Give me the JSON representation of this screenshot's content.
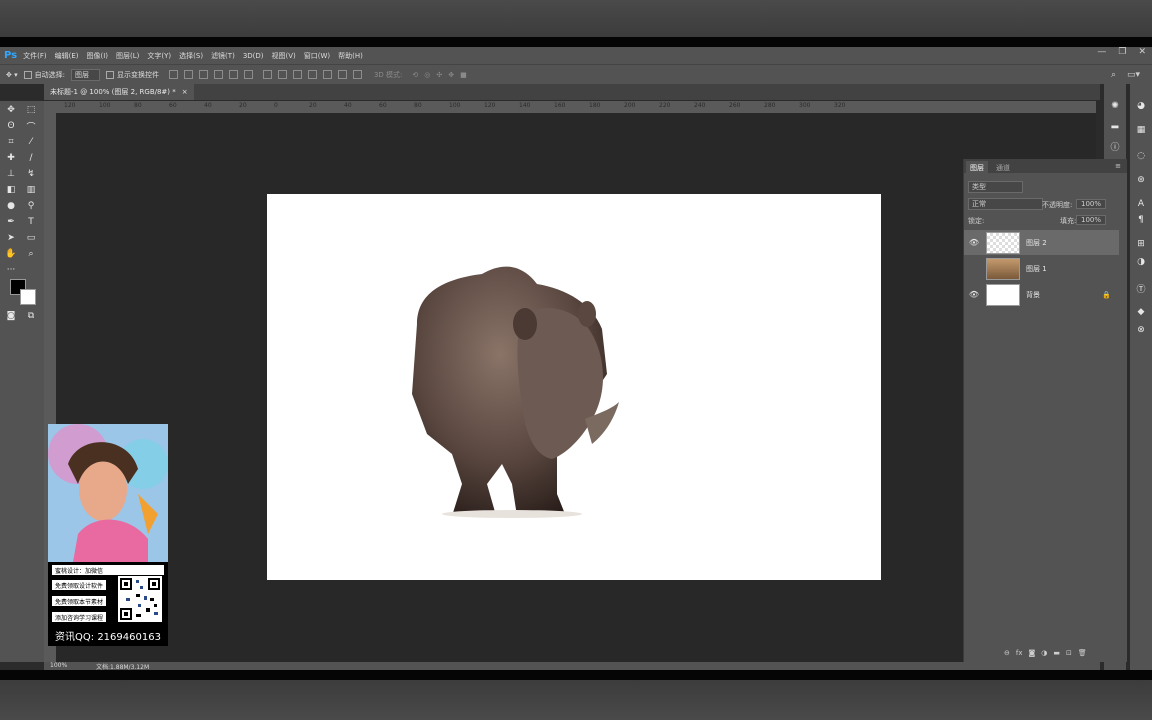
{
  "menubar": {
    "logo": "Ps",
    "items": [
      "文件(F)",
      "编辑(E)",
      "图像(I)",
      "图层(L)",
      "文字(Y)",
      "选择(S)",
      "滤镜(T)",
      "3D(D)",
      "视图(V)",
      "窗口(W)",
      "帮助(H)"
    ]
  },
  "window_controls": {
    "minimize": "—",
    "restore": "❐",
    "close": "✕"
  },
  "options": {
    "auto_select_label": "自动选择:",
    "auto_select_value": "图层",
    "show_transform_label": "显示变换控件",
    "mode_3d_label": "3D 模式:"
  },
  "document_tab": {
    "label": "未标题-1 @ 100% (图层 2, RGB/8#) *",
    "close": "×"
  },
  "ruler_h_ticks": [
    "120",
    "100",
    "80",
    "60",
    "40",
    "20",
    "0",
    "20",
    "40",
    "60",
    "80",
    "100",
    "120",
    "140",
    "160",
    "180",
    "200",
    "220",
    "240",
    "260",
    "280",
    "300",
    "320"
  ],
  "status": {
    "zoom": "100%",
    "doc_info": "文档:1.88M/3.12M"
  },
  "layers_panel": {
    "tabs": [
      "图层",
      "通道"
    ],
    "filter_label": "类型",
    "blend_mode": "正常",
    "opacity_label": "不透明度:",
    "opacity_value": "100%",
    "lock_label": "锁定:",
    "fill_label": "填充:",
    "fill_value": "100%",
    "layers": [
      {
        "name": "图层 2",
        "visible": true,
        "selected": true
      },
      {
        "name": "图层 1",
        "visible": false,
        "selected": false
      },
      {
        "name": "背景",
        "visible": true,
        "selected": false,
        "locked": true
      }
    ]
  },
  "ad": {
    "lines": [
      "蜜桃设计：加微信",
      "免费领取设计软件",
      "免费领取本节素材",
      "添加咨询学习课程"
    ],
    "qq": "资讯QQ: 2169460163"
  },
  "colors": {
    "accent": "#31a8ff",
    "panel": "#535353",
    "canvas_bg": "#282828"
  }
}
